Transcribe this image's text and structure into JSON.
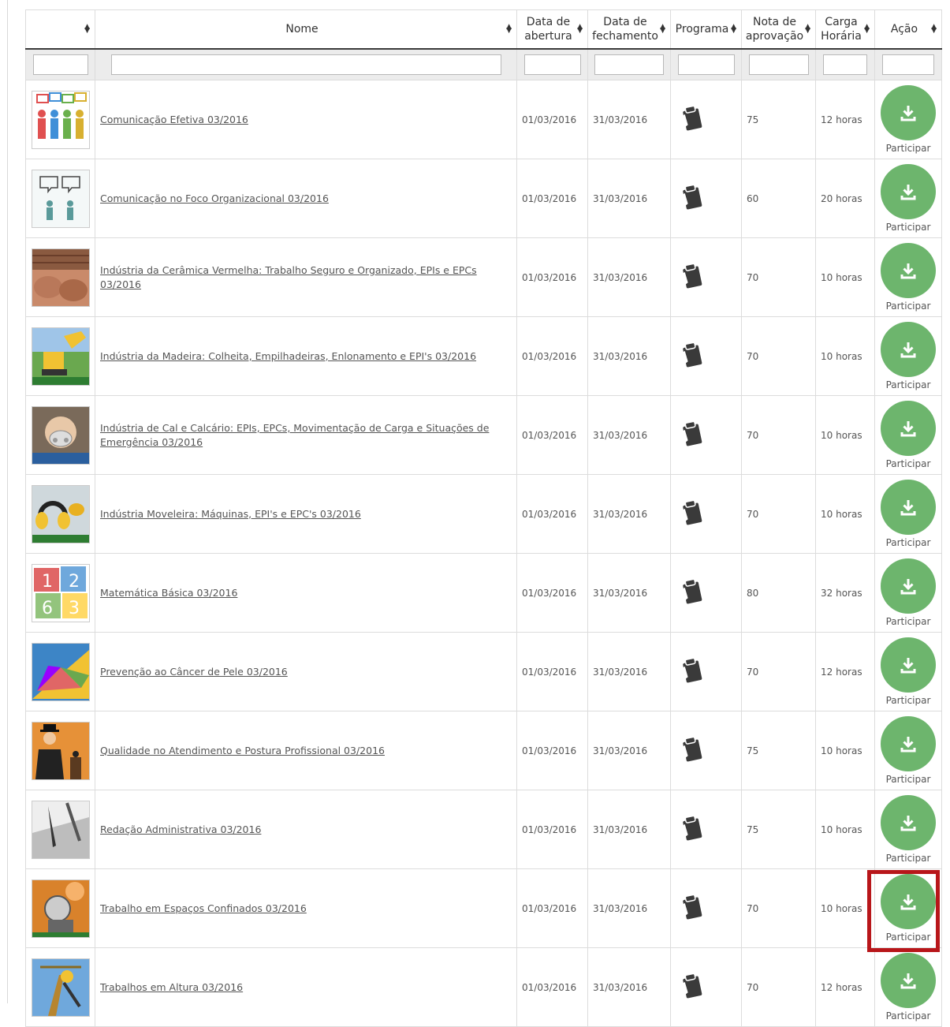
{
  "headers": {
    "image": "",
    "name": "Nome",
    "open_1": "Data de",
    "open_2": "abertura",
    "close_1": "Data de",
    "close_2": "fechamento",
    "program": "Programa",
    "grade_1": "Nota de",
    "grade_2": "aprovação",
    "hours_1": "Carga",
    "hours_2": "Horária",
    "action": "Ação"
  },
  "action_label": "Participar",
  "colors": {
    "accent": "#6db56d",
    "highlight": "#b8161a"
  },
  "courses": [
    {
      "icon": "communication-people-icon",
      "name": "Comunicação Efetiva 03/2016",
      "open": "01/03/2016",
      "close": "31/03/2016",
      "grade": "75",
      "hours": "12 horas"
    },
    {
      "icon": "communication-focus-icon",
      "name": "Comunicação no Foco Organizacional 03/2016",
      "open": "01/03/2016",
      "close": "31/03/2016",
      "grade": "60",
      "hours": "20 horas"
    },
    {
      "icon": "ceramic-bricks-icon",
      "name": "Indústria da Cerâmica Vermelha: Trabalho Seguro e Organizado, EPIs e EPCs 03/2016",
      "open": "01/03/2016",
      "close": "31/03/2016",
      "grade": "70",
      "hours": "10 horas"
    },
    {
      "icon": "wood-excavator-icon",
      "name": "Indústria da Madeira: Colheita, Empilhadeiras, Enlonamento e EPI's 03/2016",
      "open": "01/03/2016",
      "close": "31/03/2016",
      "grade": "70",
      "hours": "10 horas"
    },
    {
      "icon": "mask-worker-icon",
      "name": "Indústria de Cal e Calcário: EPIs, EPCs, Movimentação de Carga e Situações de Emergência 03/2016",
      "open": "01/03/2016",
      "close": "31/03/2016",
      "grade": "70",
      "hours": "10 horas"
    },
    {
      "icon": "hearing-protection-icon",
      "name": "Indústria Moveleira: Máquinas, EPI's e EPC's 03/2016",
      "open": "01/03/2016",
      "close": "31/03/2016",
      "grade": "70",
      "hours": "10 horas"
    },
    {
      "icon": "number-blocks-icon",
      "name": "Matemática Básica 03/2016",
      "open": "01/03/2016",
      "close": "31/03/2016",
      "grade": "80",
      "hours": "32 horas"
    },
    {
      "icon": "umbrella-icon",
      "name": "Prevenção ao Câncer de Pele 03/2016",
      "open": "01/03/2016",
      "close": "31/03/2016",
      "grade": "70",
      "hours": "12 horas"
    },
    {
      "icon": "businessman-icon",
      "name": "Qualidade no Atendimento e Postura Profissional 03/2016",
      "open": "01/03/2016",
      "close": "31/03/2016",
      "grade": "75",
      "hours": "10 horas"
    },
    {
      "icon": "pen-keyboard-icon",
      "name": "Redação Administrativa 03/2016",
      "open": "01/03/2016",
      "close": "31/03/2016",
      "grade": "75",
      "hours": "10 horas"
    },
    {
      "icon": "confined-space-worker-icon",
      "name": "Trabalho em Espaços Confinados 03/2016",
      "open": "01/03/2016",
      "close": "31/03/2016",
      "grade": "70",
      "hours": "10 horas"
    },
    {
      "icon": "height-work-icon",
      "name": "Trabalhos em Altura 03/2016",
      "open": "01/03/2016",
      "close": "31/03/2016",
      "grade": "70",
      "hours": "12 horas"
    }
  ]
}
